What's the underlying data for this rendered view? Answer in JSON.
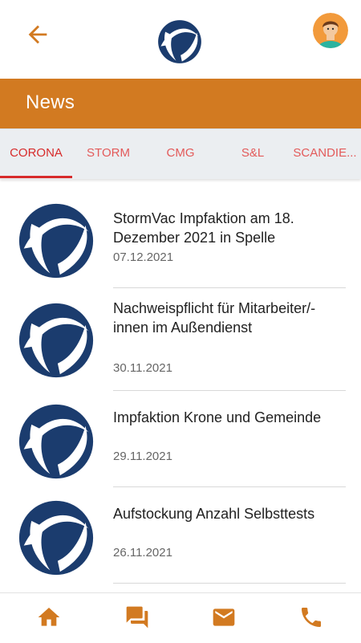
{
  "header": {
    "back_icon": "arrow-left-icon",
    "logo_icon": "brand-logo-icon",
    "avatar_icon": "user-avatar",
    "accent_color": "#d27a21",
    "logo_color": "#1b3c6e"
  },
  "news_bar": {
    "title": "News"
  },
  "tabs": [
    {
      "label": "CORONA",
      "active": true
    },
    {
      "label": "STORM"
    },
    {
      "label": "CMG"
    },
    {
      "label": "S&L"
    },
    {
      "label": "SCANDIE..."
    }
  ],
  "articles": [
    {
      "title": "StormVac Impfaktion am 18. Dezember 2021 in Spelle",
      "date": "07.12.2021"
    },
    {
      "title": "Nachweispflicht für Mitarbeiter/-innen im Außendienst",
      "date": "30.11.2021"
    },
    {
      "title": "Impfaktion Krone und Gemeinde",
      "date": "29.11.2021"
    },
    {
      "title": "Aufstockung Anzahl Selbsttests",
      "date": "26.11.2021"
    }
  ],
  "bottom_nav": {
    "items": [
      {
        "icon": "home-icon"
      },
      {
        "icon": "chat-icon"
      },
      {
        "icon": "mail-icon"
      },
      {
        "icon": "phone-icon"
      }
    ]
  }
}
